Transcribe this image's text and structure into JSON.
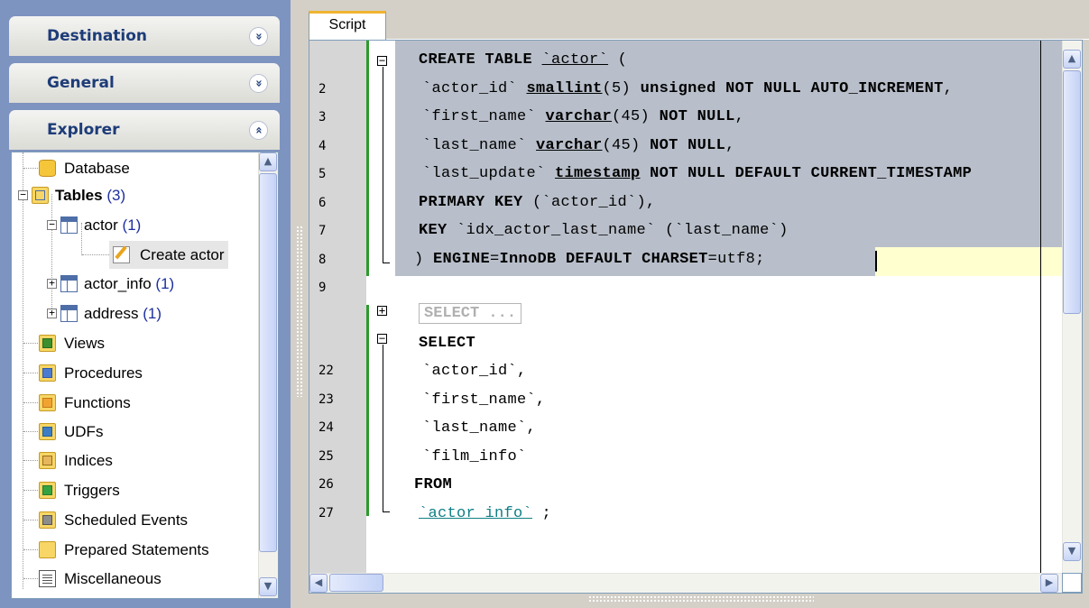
{
  "sidebar": {
    "sections": [
      {
        "label": "Destination",
        "chevron": "»"
      },
      {
        "label": "General",
        "chevron": "»"
      },
      {
        "label": "Explorer",
        "chevron": "«"
      }
    ],
    "tree": [
      {
        "label": "Database",
        "count": "",
        "icon": "database-icon"
      },
      {
        "label": "Tables",
        "count": "(3)",
        "icon": "tables-icon"
      },
      {
        "label": "actor",
        "count": "(1)",
        "icon": "table-icon"
      },
      {
        "label": "Create actor",
        "count": "",
        "icon": "create-script-icon"
      },
      {
        "label": "actor_info",
        "count": "(1)",
        "icon": "table-icon"
      },
      {
        "label": "address",
        "count": "(1)",
        "icon": "table-icon"
      },
      {
        "label": "Views",
        "count": "",
        "icon": "views-icon"
      },
      {
        "label": "Procedures",
        "count": "",
        "icon": "procedures-icon"
      },
      {
        "label": "Functions",
        "count": "",
        "icon": "functions-icon"
      },
      {
        "label": "UDFs",
        "count": "",
        "icon": "udfs-icon"
      },
      {
        "label": "Indices",
        "count": "",
        "icon": "indices-icon"
      },
      {
        "label": "Triggers",
        "count": "",
        "icon": "triggers-icon"
      },
      {
        "label": "Scheduled Events",
        "count": "",
        "icon": "scheduled-events-icon"
      },
      {
        "label": "Prepared Statements",
        "count": "",
        "icon": "prepared-statements-icon"
      },
      {
        "label": "Miscellaneous",
        "count": "",
        "icon": "miscellaneous-icon"
      }
    ]
  },
  "editor": {
    "tab_label": "Script",
    "line_numbers": [
      "2",
      "3",
      "4",
      "5",
      "6",
      "7",
      "8",
      "9",
      "22",
      "23",
      "24",
      "25",
      "26",
      "27"
    ],
    "collapsed_block": "SELECT ...",
    "colors": {
      "selection": "#b8bfca",
      "current_line": "#ffffd0",
      "gutter": "#d6d6d6",
      "change_bar": "#2b9a2b",
      "identifier_link": "#0f7f86"
    }
  },
  "scrollbar_icons": {
    "up": "scroll-up-icon",
    "down": "scroll-down-icon",
    "left": "scroll-left-icon",
    "right": "scroll-right-icon"
  }
}
